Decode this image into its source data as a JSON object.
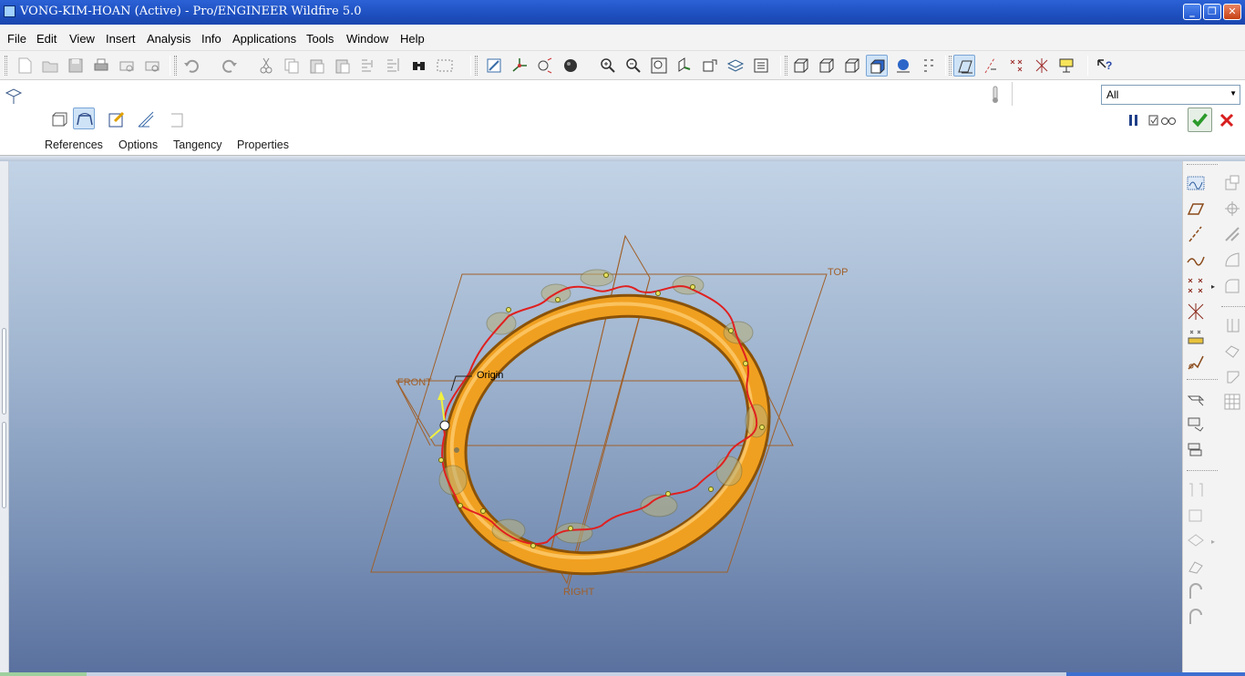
{
  "window": {
    "title": "VONG-KIM-HOAN (Active) - Pro/ENGINEER Wildfire 5.0",
    "minimize": "_",
    "maximize": "❐",
    "close": "✕"
  },
  "menu": [
    "File",
    "Edit",
    "View",
    "Insert",
    "Analysis",
    "Info",
    "Applications",
    "Tools",
    "Window",
    "Help"
  ],
  "dashboard": {
    "tabs": [
      "References",
      "Options",
      "Tangency",
      "Properties"
    ],
    "filter_value": "All"
  },
  "model": {
    "datum_planes": [
      "TOP",
      "FRONT",
      "RIGHT"
    ],
    "coordinate_system": "Origin"
  },
  "colors": {
    "ring": "#f0a020",
    "curve": "#e02020",
    "datum": "#a0602a",
    "confirm": "#2a9a2a",
    "cancel": "#d81e1e"
  },
  "icons": {
    "toolbar": [
      "new-icon",
      "open-icon",
      "save-icon",
      "print-icon",
      "send-mail-icon",
      "send-link-icon",
      "undo-icon",
      "redo-icon",
      "cut-icon",
      "copy-icon",
      "paste-icon",
      "paste-special-icon",
      "regenerate-icon",
      "regen-manager-icon",
      "find-icon",
      "select-box-icon",
      "repaint-icon",
      "spin-center-icon",
      "orient-mode-icon",
      "appearance-sphere-icon",
      "zoom-in-icon",
      "zoom-out-icon",
      "refit-icon",
      "reorient-icon",
      "saved-views-icon",
      "layers-icon",
      "view-manager-icon",
      "wireframe-icon",
      "hidden-line-icon",
      "no-hidden-icon",
      "shading-icon",
      "enhanced-realism-icon",
      "display-style-icon",
      "plane-display-icon",
      "axis-display-icon",
      "point-display-icon",
      "csys-display-icon",
      "annotation-display-icon",
      "context-help-icon"
    ],
    "right": [
      "sketch-tool-icon",
      "datum-plane-icon",
      "datum-axis-icon",
      "datum-curve-icon",
      "datum-point-icon",
      "datum-csys-icon",
      "analysis-feature-icon",
      "publish-geometry-icon",
      "extrude-icon",
      "revolve-icon",
      "sweep-icon",
      "blend-icon",
      "boundary-blend-icon",
      "mirror-icon",
      "merge-icon",
      "trim-icon",
      "pattern-icon",
      "hole-icon",
      "shell-icon",
      "rib-icon",
      "draft-icon",
      "round-icon",
      "chamfer-icon"
    ]
  }
}
